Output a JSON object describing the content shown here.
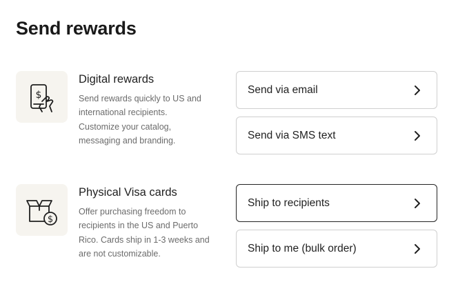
{
  "page": {
    "title": "Send rewards"
  },
  "sections": [
    {
      "title": "Digital rewards",
      "description": "Send rewards quickly to US and international recipients. Customize your catalog, messaging and branding.",
      "icon": "phone-dollar-icon",
      "options": [
        {
          "label": "Send via email",
          "icon": "chevron-right-icon"
        },
        {
          "label": "Send via SMS text",
          "icon": "chevron-right-icon"
        }
      ]
    },
    {
      "title": "Physical Visa cards",
      "description": "Offer purchasing freedom to recipients in the US and Puerto Rico. Cards ship in 1-3 weeks and are not customizable.",
      "icon": "box-dollar-icon",
      "options": [
        {
          "label": "Ship to recipients",
          "icon": "chevron-right-icon",
          "selected": true
        },
        {
          "label": "Ship to me (bulk order)",
          "icon": "chevron-right-icon"
        }
      ]
    }
  ],
  "colors": {
    "icon_bg": "#f6f4ef",
    "border": "#cfcfcf",
    "border_selected": "#222222",
    "muted_text": "#6b6b6b"
  }
}
